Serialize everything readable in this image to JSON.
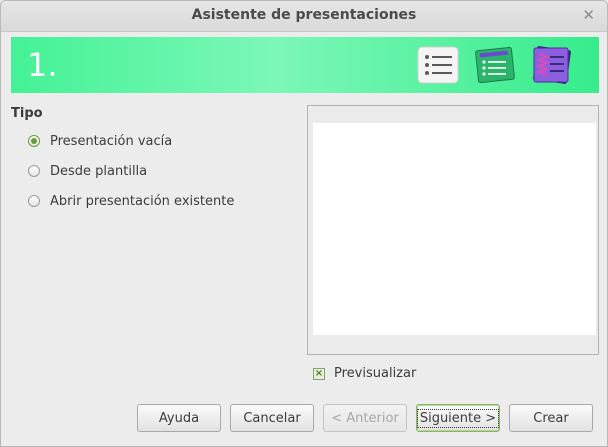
{
  "window": {
    "title": "Asistente de presentaciones"
  },
  "banner": {
    "step": "1.",
    "icons": [
      "list-icon",
      "green-list-icon",
      "purple-list-icon"
    ]
  },
  "type_section": {
    "label": "Tipo",
    "options": [
      {
        "label": "Presentación vacía",
        "selected": true
      },
      {
        "label": "Desde plantilla",
        "selected": false
      },
      {
        "label": "Abrir presentación existente",
        "selected": false
      }
    ]
  },
  "preview": {
    "checkbox_label": "Previsualizar",
    "checked": true
  },
  "buttons": {
    "help": "Ayuda",
    "cancel": "Cancelar",
    "previous": "< Anterior",
    "next": "Siguiente >",
    "create": "Crear"
  },
  "colors": {
    "banner": "#44f295",
    "accent_check": "#6a9b3c"
  }
}
